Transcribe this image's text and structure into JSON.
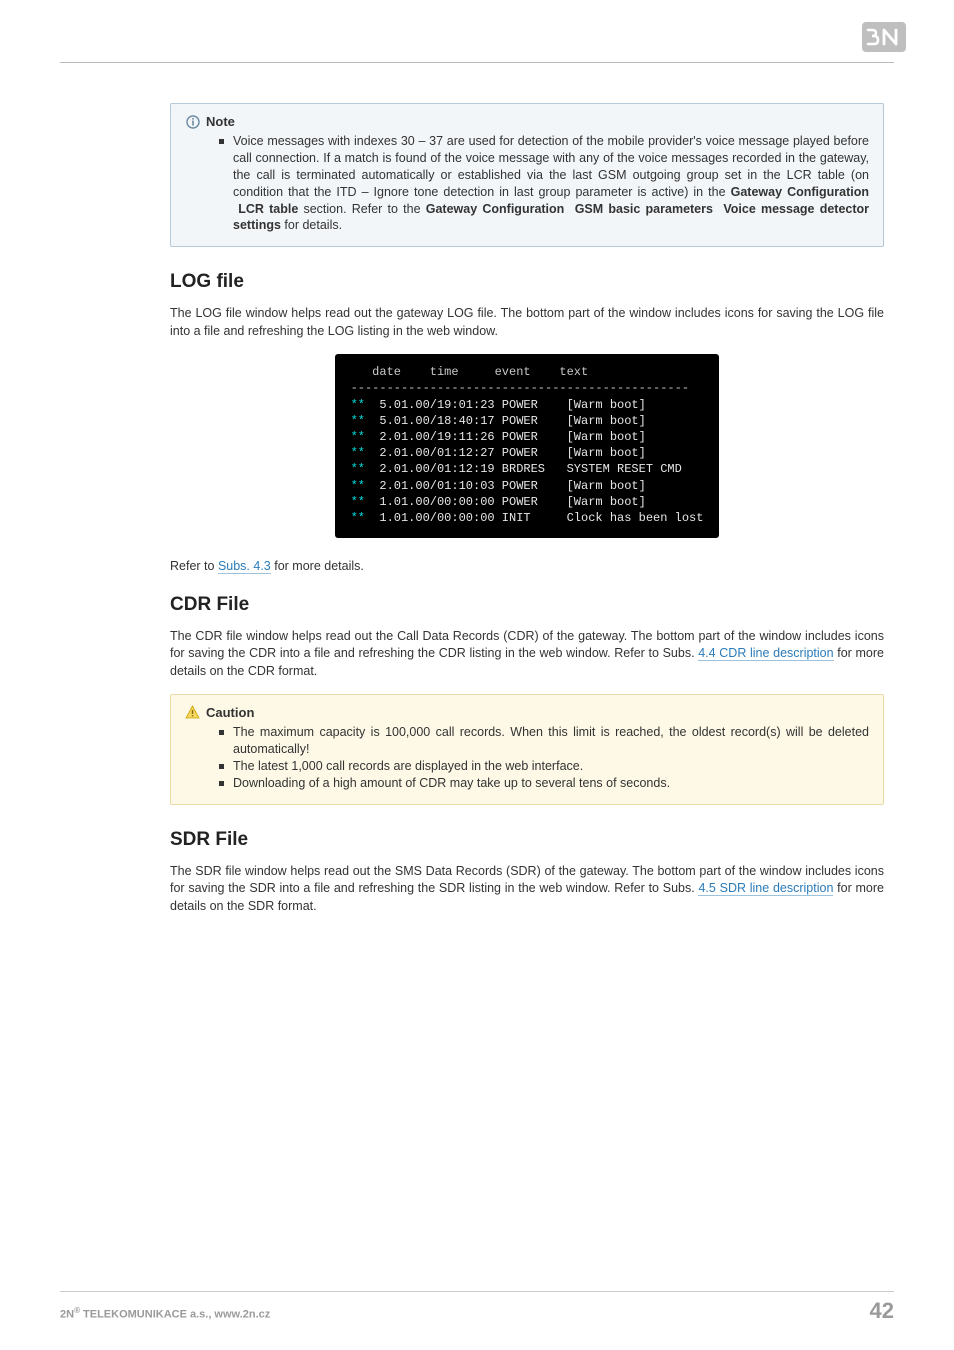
{
  "note": {
    "title": "Note",
    "items": [
      "Voice messages with indexes 30 – 37 are used for detection of the mobile provider's voice message played before call connection. If a match is found of the voice message with any of the voice messages recorded in the gateway, the call is terminated automatically or established via the last GSM outgoing group set in the LCR table (on condition that the ITD – Ignore tone detection in last group parameter is active) in the <b>Gateway Configuration &nbsp;LCR table</b> section. Refer to the <b>Gateway Configuration &nbsp;GSM basic parameters &nbsp;Voice message detector settings</b> for details."
    ]
  },
  "sections": {
    "log": {
      "heading": "LOG file",
      "para": "The LOG file window helps read out the gateway LOG file. The bottom part of the window includes icons for saving the LOG file into a file and refreshing the LOG listing in the web window.",
      "refer_pre": "Refer to ",
      "refer_link": "Subs. 4.3",
      "refer_post": " for more details."
    },
    "cdr": {
      "heading": "CDR File",
      "para_pre": "The CDR file window helps read out the Call Data Records (CDR) of the gateway. The bottom part of the window includes icons for saving the CDR into a file and refreshing the CDR listing in the web window. Refer to Subs. ",
      "para_link": "4.4 CDR line description",
      "para_post": " for more details on the CDR format."
    },
    "sdr": {
      "heading": "SDR File",
      "para_pre": "The SDR file window helps read out the SMS Data Records (SDR) of the gateway. The bottom part of the window includes icons for saving the SDR into a file and refreshing the SDR listing in the web window. Refer to Subs. ",
      "para_link": "4.5 SDR line description",
      "para_post": " for more details on the SDR format."
    }
  },
  "caution": {
    "title": "Caution",
    "items": [
      "The maximum capacity is 100,000 call records. When this limit is reached, the oldest record(s) will be deleted automatically!",
      "The latest 1,000 call records are displayed in the web interface.",
      "Downloading of a high amount of CDR may take up to several tens of seconds."
    ]
  },
  "terminal": {
    "header": "   date    time     event    text",
    "divider": "-----------------------------------------------",
    "rows": [
      {
        "dt": "5.01.00/19:01:23",
        "ev": "POWER ",
        "tx": "[Warm boot]"
      },
      {
        "dt": "5.01.00/18:40:17",
        "ev": "POWER ",
        "tx": "[Warm boot]"
      },
      {
        "dt": "2.01.00/19:11:26",
        "ev": "POWER ",
        "tx": "[Warm boot]"
      },
      {
        "dt": "2.01.00/01:12:27",
        "ev": "POWER ",
        "tx": "[Warm boot]"
      },
      {
        "dt": "2.01.00/01:12:19",
        "ev": "BRDRES",
        "tx": "SYSTEM RESET CMD"
      },
      {
        "dt": "2.01.00/01:10:03",
        "ev": "POWER ",
        "tx": "[Warm boot]"
      },
      {
        "dt": "1.01.00/00:00:00",
        "ev": "POWER ",
        "tx": "[Warm boot]"
      },
      {
        "dt": "1.01.00/00:00:00",
        "ev": "INIT  ",
        "tx": "Clock has been lost"
      }
    ]
  },
  "footer": {
    "left_pre": "2N",
    "left_sup": "®",
    "left_post": " TELEKOMUNIKACE a.s., www.2n.cz",
    "page": "42"
  }
}
